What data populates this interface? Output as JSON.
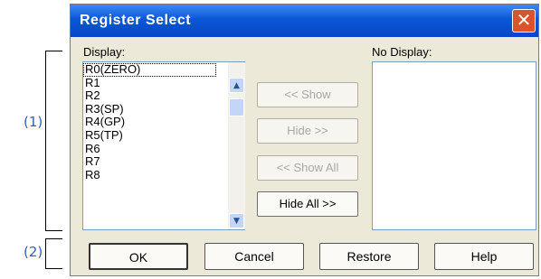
{
  "annotations": {
    "one": "(1)",
    "two": "(2)"
  },
  "dialog": {
    "title": "Register Select",
    "close_glyph": "✕",
    "display_label": "Display:",
    "nodisplay_label": "No Display:",
    "display_items": [
      "R0(ZERO)",
      "R1",
      "R2",
      "R3(SP)",
      "R4(GP)",
      "R5(TP)",
      "R6",
      "R7",
      "R8"
    ],
    "selected_index": 0,
    "nodisplay_items": [],
    "buttons": {
      "show": "<< Show",
      "hide": "Hide >>",
      "show_all": "<< Show All",
      "hide_all": "Hide All >>",
      "ok": "OK",
      "cancel": "Cancel",
      "restore": "Restore",
      "help": "Help"
    },
    "icons": {
      "up": "scroll-up-arrow",
      "down": "scroll-down-arrow"
    },
    "colors": {
      "titlebar": "#0a57d6",
      "close": "#d9542a",
      "annotation": "#2f5fbf",
      "face": "#ece9d8"
    }
  }
}
